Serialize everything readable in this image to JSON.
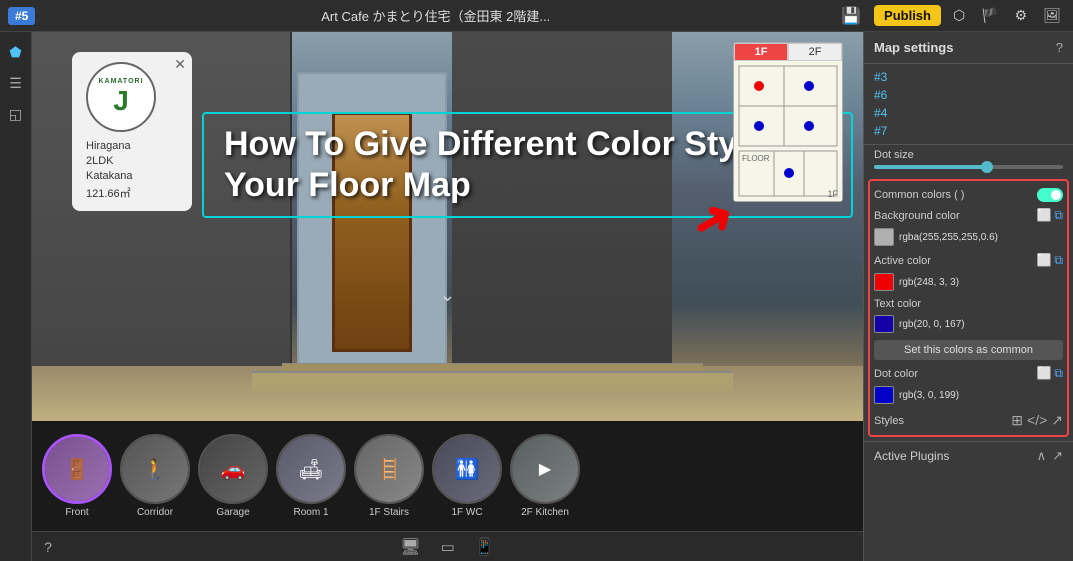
{
  "topbar": {
    "app_num": "#5",
    "title": "Art Cafe かまとり住宅（金田東 2階建...",
    "publish_label": "Publish",
    "share_icon": "⬡",
    "flag_icon": "🏴",
    "settings_icon": "⚙",
    "image_icon": "🖼"
  },
  "left_sidebar": {
    "icons": [
      "⬟",
      "☰",
      "◱"
    ]
  },
  "main_view": {
    "text_overlay_title": "How To Give Different Color Style To Your Floor Map",
    "info_card": {
      "logo_top": "KAMATORI",
      "type": "Hiragana",
      "size": "2LDK",
      "style": "Katakana",
      "area": "121.66㎡"
    }
  },
  "minimap": {
    "tab_1f": "1F",
    "tab_2f": "2F",
    "tab_1f_active": true
  },
  "thumbnails": [
    {
      "label": "Front",
      "active": true,
      "color": "#6a4090"
    },
    {
      "label": "Corridor",
      "active": false,
      "color": "#555"
    },
    {
      "label": "Garage",
      "active": false,
      "color": "#666"
    },
    {
      "label": "Room 1",
      "active": false,
      "color": "#777"
    },
    {
      "label": "1F Stairs",
      "active": false,
      "color": "#888"
    },
    {
      "label": "1F WC",
      "active": false,
      "color": "#555"
    },
    {
      "label": "2F Kitchen",
      "active": false,
      "color": "#666"
    }
  ],
  "bottom_bar": {
    "desktop_icon": "🖥",
    "tablet_icon": "▭",
    "mobile_icon": "📱"
  },
  "right_panel": {
    "title": "Map settings",
    "help_icon": "?",
    "map_items": [
      "#3",
      "#6",
      "#4",
      "#7"
    ],
    "dot_size_label": "Dot size",
    "dot_size_value": 60,
    "colors_section": {
      "header_label": "Common colors ( )",
      "toggle_on": true,
      "background_color_label": "Background color",
      "background_color_value": "rgba(255,255,255,0.6)",
      "background_swatch": "#f0f0f0",
      "active_color_label": "Active color",
      "active_color_value": "rgb(248, 3, 3)",
      "active_swatch": "#e00",
      "text_color_label": "Text color",
      "text_color_value": "rgb(20, 0, 167)",
      "text_swatch": "#1400a7",
      "set_common_label": "Set this colors as common",
      "dot_color_label": "Dot color",
      "dot_color_value": "rgb(3, 0, 199)",
      "dot_swatch": "#0300c7",
      "styles_label": "Styles"
    }
  },
  "active_plugins": {
    "label": "Active Plugins",
    "expand_icon": "^",
    "external_icon": "↗"
  }
}
